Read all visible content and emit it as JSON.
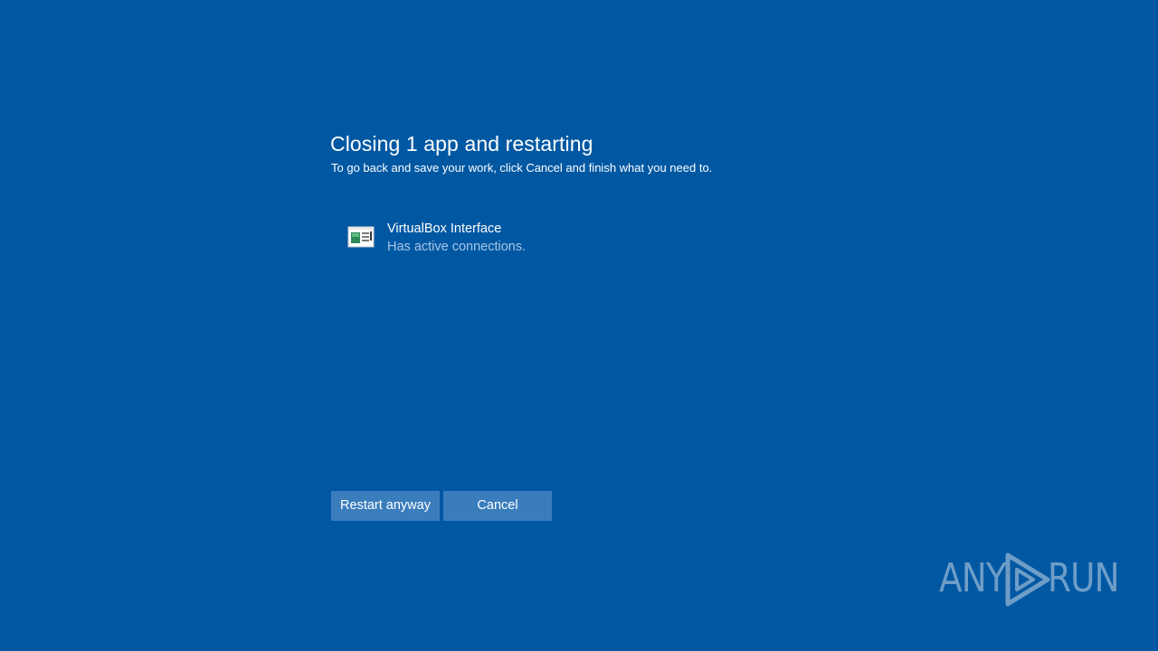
{
  "dialog": {
    "title": "Closing 1 app and restarting",
    "subtitle": "To go back and save your work, click Cancel and finish what you need to."
  },
  "apps": [
    {
      "name": "VirtualBox Interface",
      "status": "Has active connections.",
      "icon": "application-window-icon"
    }
  ],
  "buttons": {
    "restart_label": "Restart anyway",
    "cancel_label": "Cancel"
  },
  "watermark": {
    "left_text": "ANY",
    "right_text": "RUN",
    "icon": "play-triangle-icon"
  },
  "colors": {
    "background": "#0058a3",
    "button": "#3a7dbd",
    "secondary_text": "#a9c6e6"
  }
}
